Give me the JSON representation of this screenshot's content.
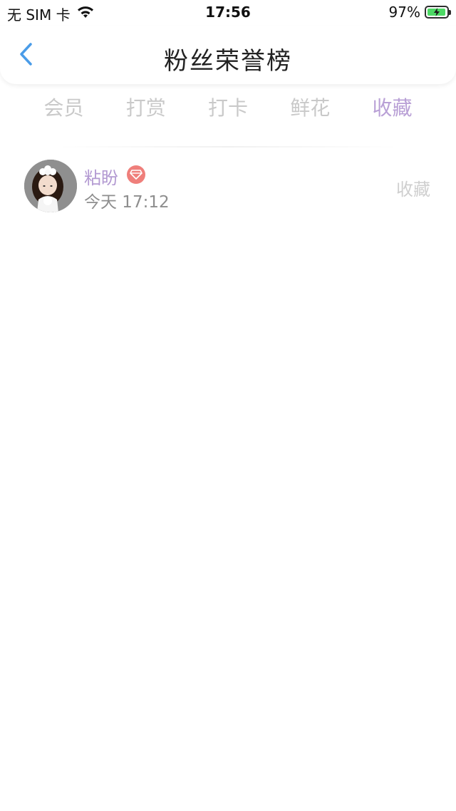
{
  "status_bar": {
    "carrier": "无 SIM 卡",
    "time": "17:56",
    "battery_percent": "97%",
    "icons": {
      "wifi": "wifi-icon",
      "battery": "battery-charging-icon"
    },
    "battery_color": "#4cd964"
  },
  "nav": {
    "title": "粉丝荣誉榜",
    "back_icon": "chevron-left-icon",
    "back_color": "#4a9ce8"
  },
  "tabs": [
    {
      "label": "会员",
      "active": false
    },
    {
      "label": "打赏",
      "active": false
    },
    {
      "label": "打卡",
      "active": false
    },
    {
      "label": "鲜花",
      "active": false
    },
    {
      "label": "收藏",
      "active": true
    }
  ],
  "colors": {
    "accent": "#b9a0d6",
    "inactive_tab": "#c9c9c9",
    "name": "#b39ad2",
    "badge": "#ef7f7b"
  },
  "list": [
    {
      "name": "粘盼",
      "badge_icon": "diamond-badge-icon",
      "time": "今天 17:12",
      "action": "收藏"
    }
  ]
}
